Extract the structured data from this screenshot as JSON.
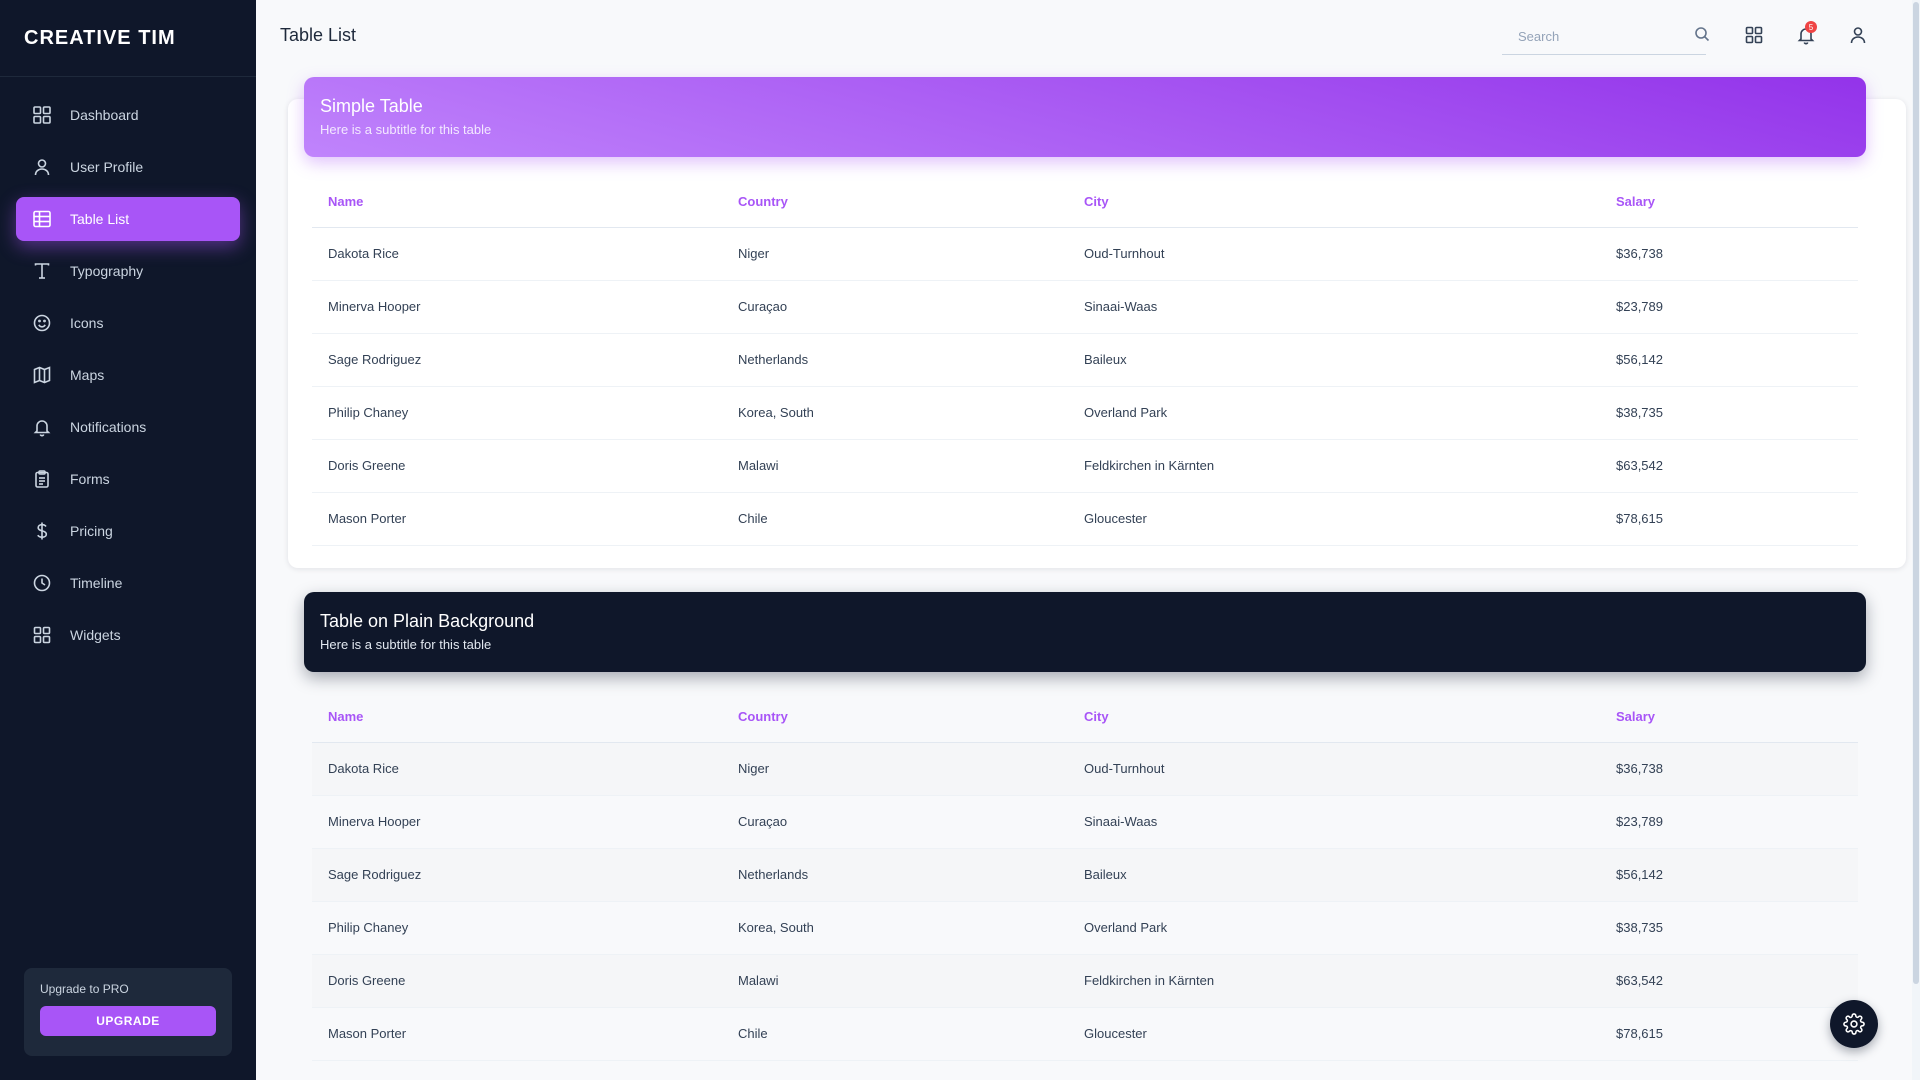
{
  "brand": "CREATIVE TIM",
  "sidebar": {
    "items": [
      {
        "label": "Dashboard",
        "icon": "dashboard-icon"
      },
      {
        "label": "User Profile",
        "icon": "user-icon"
      },
      {
        "label": "Table List",
        "icon": "table-icon",
        "active": true
      },
      {
        "label": "Typography",
        "icon": "typography-icon"
      },
      {
        "label": "Icons",
        "icon": "smiley-icon"
      },
      {
        "label": "Maps",
        "icon": "map-icon"
      },
      {
        "label": "Notifications",
        "icon": "bell-icon"
      },
      {
        "label": "Forms",
        "icon": "clipboard-icon"
      },
      {
        "label": "Pricing",
        "icon": "dollar-icon"
      },
      {
        "label": "Timeline",
        "icon": "clock-icon"
      },
      {
        "label": "Widgets",
        "icon": "widgets-icon"
      }
    ],
    "upgrade": {
      "text": "Upgrade to PRO",
      "button": "UPGRADE"
    }
  },
  "header": {
    "title": "Table List",
    "search_placeholder": "Search",
    "notification_count": "5"
  },
  "tables": {
    "simple": {
      "title": "Simple Table",
      "subtitle": "Here is a subtitle for this table"
    },
    "plain": {
      "title": "Table on Plain Background",
      "subtitle": "Here is a subtitle for this table"
    },
    "columns": [
      "Name",
      "Country",
      "City",
      "Salary"
    ],
    "rows": [
      [
        "Dakota Rice",
        "Niger",
        "Oud-Turnhout",
        "$36,738"
      ],
      [
        "Minerva Hooper",
        "Curaçao",
        "Sinaai-Waas",
        "$23,789"
      ],
      [
        "Sage Rodriguez",
        "Netherlands",
        "Baileux",
        "$56,142"
      ],
      [
        "Philip Chaney",
        "Korea, South",
        "Overland Park",
        "$38,735"
      ],
      [
        "Doris Greene",
        "Malawi",
        "Feldkirchen in Kärnten",
        "$63,542"
      ],
      [
        "Mason Porter",
        "Chile",
        "Gloucester",
        "$78,615"
      ]
    ]
  },
  "colors": {
    "accent": "#a855f7",
    "sidebar_bg": "#0f172a",
    "dark_header": "#0f172a",
    "notification_badge": "#ef4444"
  }
}
